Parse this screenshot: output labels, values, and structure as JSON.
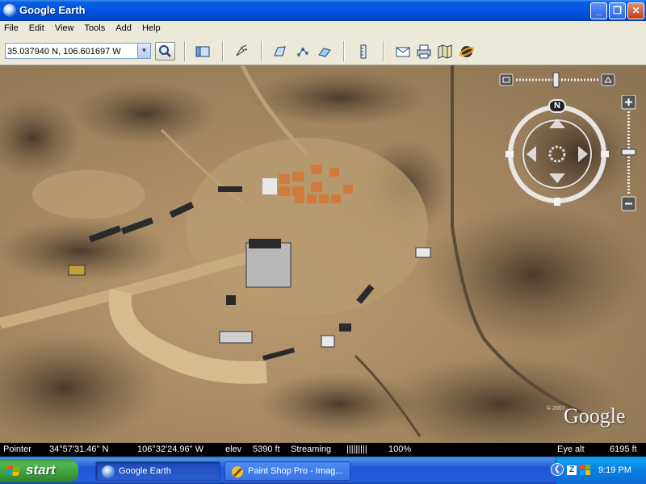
{
  "window": {
    "title": "Google Earth",
    "controls": {
      "minimize": "_",
      "maximize": "❐",
      "close": "✕"
    }
  },
  "menu": {
    "items": [
      "File",
      "Edit",
      "View",
      "Tools",
      "Add",
      "Help"
    ]
  },
  "toolbar": {
    "search_value": "35.037940 N, 106.601697 W",
    "icons": [
      "sidebar-icon",
      "placemark-icon",
      "polygon-icon",
      "path-icon",
      "image-overlay-icon",
      "ruler-icon",
      "email-icon",
      "print-icon",
      "maps-icon",
      "sky-icon"
    ]
  },
  "map": {
    "compass_north": "N",
    "copyright": "© 2007",
    "logo": "Google"
  },
  "status": {
    "pointer_label": "Pointer",
    "latitude": "34°57'31.46\" N",
    "longitude": "106°32'24.96\" W",
    "elev_label": "elev",
    "elev_value": "5390 ft",
    "streaming_label": "Streaming",
    "streaming_bar": "|||||||||",
    "streaming_percent": "100%",
    "eye_alt_label": "Eye alt",
    "eye_alt_value": "6195 ft"
  },
  "taskbar": {
    "start_label": "start",
    "tasks": [
      {
        "label": "Google Earth",
        "active": true
      },
      {
        "label": "Paint Shop Pro - Imag...",
        "active": false
      }
    ],
    "clock": "9:19 PM"
  },
  "colors": {
    "title_bar": "#0054e3",
    "taskbar": "#245edb",
    "start_green": "#3a9a3a",
    "terrain": "#a78863"
  }
}
